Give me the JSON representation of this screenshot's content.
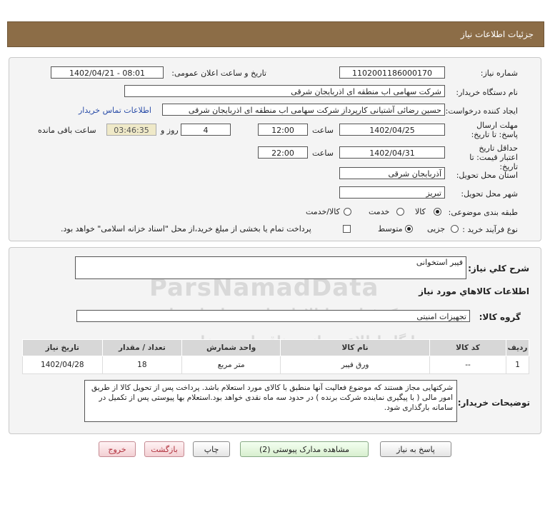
{
  "header": {
    "title": "جزئیات اطلاعات نیاز"
  },
  "form": {
    "need_number_label": "شماره نیاز:",
    "need_number": "1102001186000170",
    "announce_label": "تاریخ و ساعت اعلان عمومی:",
    "announce_value": "1402/04/21 - 08:01",
    "buyer_org_label": "نام دستگاه خریدار:",
    "buyer_org": "شرکت سهامی اب منطقه ای اذربایجان شرقی",
    "requester_label": "ایجاد کننده درخواست:",
    "requester": "حسین رضائی آشتیانی کارپرداز شرکت سهامی اب منطقه ای اذربایجان شرقی",
    "buyer_contact_link": "اطلاعات تماس خریدار",
    "reply_deadline_label": "مهلت ارسال پاسخ: تا تاریخ:",
    "reply_date": "1402/04/25",
    "time_label": "ساعت",
    "reply_time": "12:00",
    "days_value": "4",
    "days_label": "روز و",
    "remaining_time": "03:46:35",
    "remaining_label": "ساعت باقی مانده",
    "price_validity_label": "حداقل تاریخ اعتبار قیمت: تا تاریخ:",
    "price_date": "1402/04/31",
    "price_time": "22:00",
    "province_label": "استان محل تحویل:",
    "province": "آذربایجان شرقی",
    "city_label": "شهر محل تحویل:",
    "city": "تبریز",
    "category_label": "طبقه بندی موضوعی:",
    "category_options": [
      "کالا",
      "خدمت",
      "کالا/خدمت"
    ],
    "purchase_type_label": "نوع فرآیند خرید :",
    "purchase_options": [
      "جزیی",
      "متوسط"
    ],
    "treasury_note": "پرداخت تمام یا بخشی از مبلغ خرید،از محل \"اسناد خزانه اسلامی\" خواهد بود."
  },
  "need": {
    "summary_label": "شرح کلي نياز:",
    "summary": "فیبر استخوانی",
    "goods_info_title": "اطلاعات کالاهاي مورد نياز",
    "goods_group_label": "گروه کالا:",
    "goods_group": "تجهیزات امنیتی"
  },
  "table": {
    "headers": [
      "ردیف",
      "کد کالا",
      "نام کالا",
      "واحد شمارش",
      "تعداد / مقدار",
      "تاریخ نیاز"
    ],
    "rows": [
      [
        "1",
        "--",
        "ورق فیبر",
        "متر مربع",
        "18",
        "1402/04/28"
      ]
    ]
  },
  "buyer_notes": {
    "label": "توضیحات خریدار:",
    "text": "شرکتهایی مجاز هستند که موضوع فعالیت آنها منطبق با کالای مورد استعلام باشد. پرداخت پس از تحویل کالا  از طریق امور مالی ( با پیگیری نماینده شرکت برنده )  در حدود سه  ماه نقدی خواهد بود.استعلام بها پیوستی پس از تکمیل در سامانه بارگذاری شود."
  },
  "buttons": {
    "reply": "پاسخ به نیاز",
    "attachments": "مشاهده مدارک پیوستی (2)",
    "print": "چاپ",
    "back": "بازگشت",
    "exit": "خروج"
  },
  "watermark": {
    "brand": "ParsNamadData",
    "line1": "مرکز فراوری اطلاعات پارس نماد داده ها",
    "line2": "پایگاه اطلاع رسانی مناقصات و مزایده",
    "phone": "۰۲۱-۸۸۳۴۹۶۷۰-۵"
  },
  "colors": {
    "header_bg": "#8c6d47",
    "panel_bg": "#f4f4f4",
    "link": "#2a4da8",
    "timer_bg": "#efe9c8"
  }
}
